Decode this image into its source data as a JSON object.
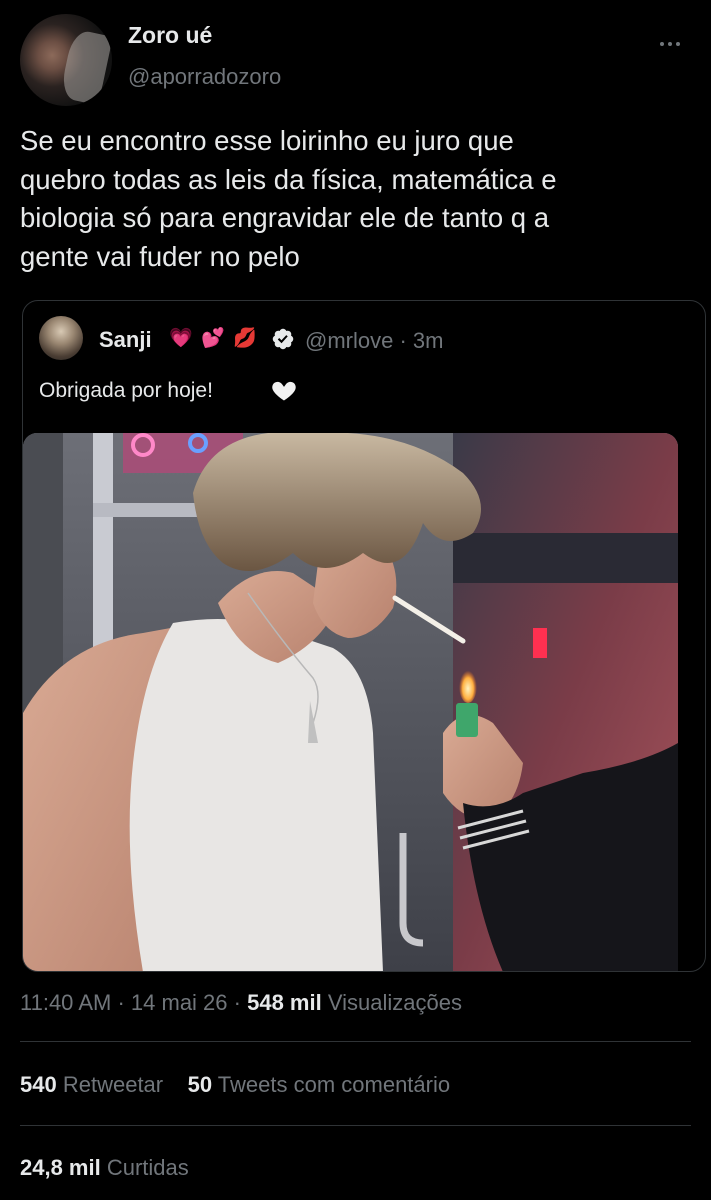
{
  "tweet": {
    "author": {
      "name": "Zoro ué",
      "handle": "@aporradozoro"
    },
    "text_lines": [
      "Se eu encontro esse loirinho eu juro que",
      "quebro todas as leis da física, matemática e",
      "biologia só para engravidar ele de tanto q a",
      "gente vai fuder no pelo"
    ],
    "more_icon": "more-horizontal-icon",
    "quoted": {
      "name": "Sanji",
      "emojis": [
        "💗",
        "💕",
        "💋"
      ],
      "verified_icon": "verified-badge-icon",
      "handle": "@mrlove",
      "separator": "·",
      "time": "3m",
      "text": "Obrigada por hoje!",
      "text_emoji_icon": "white-heart-icon"
    },
    "meta": {
      "time": "11:40 AM",
      "sep1": "·",
      "date": "14 mai 26",
      "sep2": "·",
      "views_count": "548 mil",
      "views_label": "Visualizações"
    },
    "stats": {
      "retweets_count": "540",
      "retweets_label": "Retweetar",
      "quotes_count": "50",
      "quotes_label": "Tweets com comentário",
      "likes_count": "24,8 mil",
      "likes_label": "Curtidas"
    }
  },
  "colors": {
    "background": "#000000",
    "primary_text": "#e7e9ea",
    "secondary_text": "#71767b",
    "border": "#2f3336",
    "verified_blue": "#1d9bf0"
  }
}
